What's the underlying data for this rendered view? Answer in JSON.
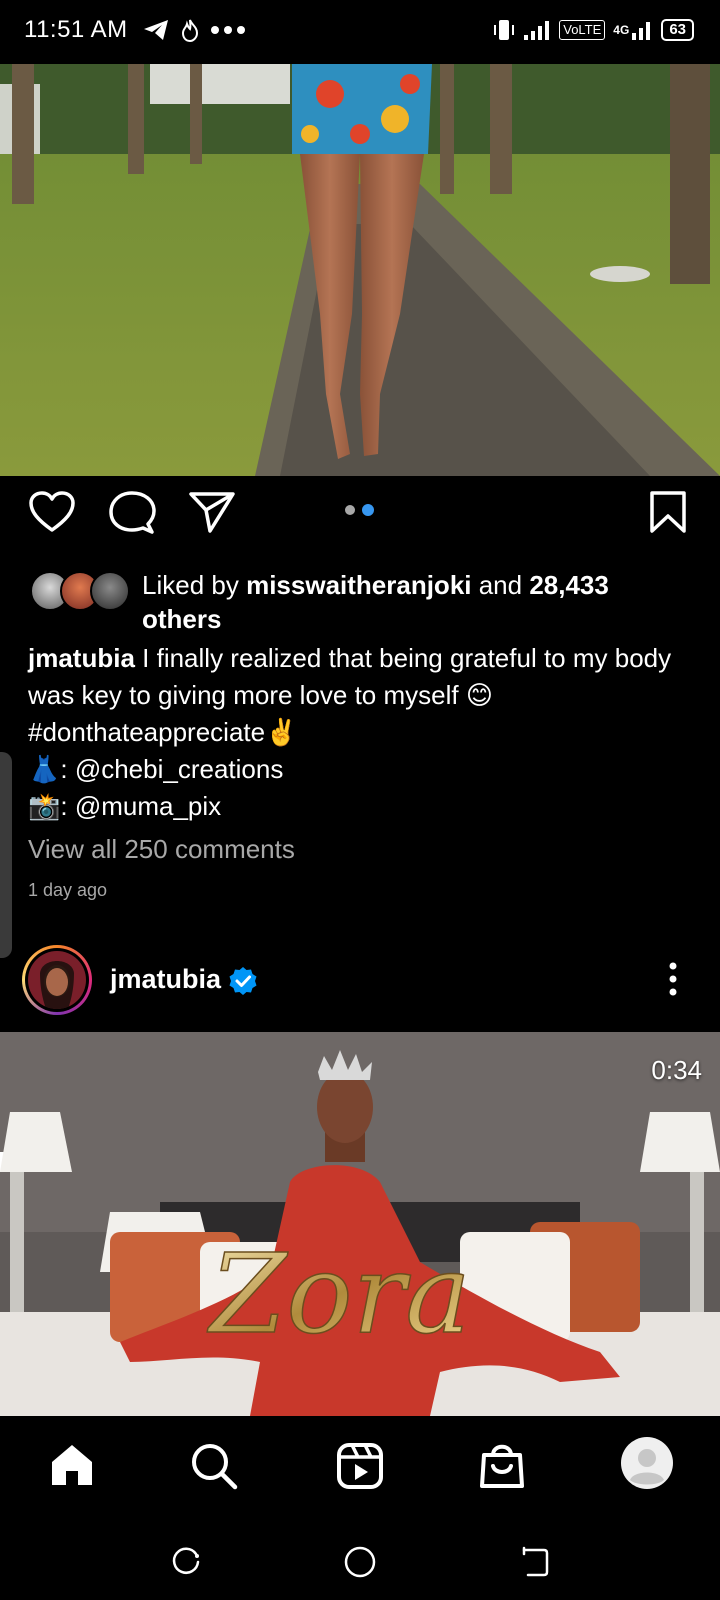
{
  "status_bar": {
    "time": "11:51 AM",
    "left_icons": [
      "telegram-icon",
      "fire-icon",
      "more-dots-icon"
    ],
    "network_label": "VoLTE",
    "network_gen": "4G",
    "battery": "63"
  },
  "post1": {
    "carousel_dots": 2,
    "carousel_active": 2,
    "likes": {
      "prefix": "Liked by ",
      "user": "misswaitheranjoki",
      "middle": " and ",
      "count": "28,433",
      "suffix": "others"
    },
    "caption": {
      "username": "jmatubia",
      "text": " I finally realized that being grateful to my body was key to giving more love to myself 😊",
      "hashtag_line": "#donthateappreciate✌️",
      "credit1_emoji": "👗",
      "credit1_text": ": @chebi_creations",
      "credit2_emoji": "📸",
      "credit2_text": ": @muma_pix"
    },
    "view_comments": "View all 250 comments",
    "time_ago": "1 day ago"
  },
  "post2": {
    "username": "jmatubia",
    "verified": true,
    "video_duration": "0:34",
    "video_overlay_text": "Zora"
  },
  "bottom_nav": {
    "items": [
      "home-icon",
      "search-icon",
      "reels-icon",
      "shop-icon",
      "profile-avatar"
    ]
  },
  "android_nav": {
    "items": [
      "recent-apps-icon",
      "home-circle-icon",
      "back-icon"
    ]
  },
  "colors": {
    "accent_blue": "#3797f0",
    "verified_blue": "#0095f6",
    "secondary_text": "#a8a8a8"
  }
}
